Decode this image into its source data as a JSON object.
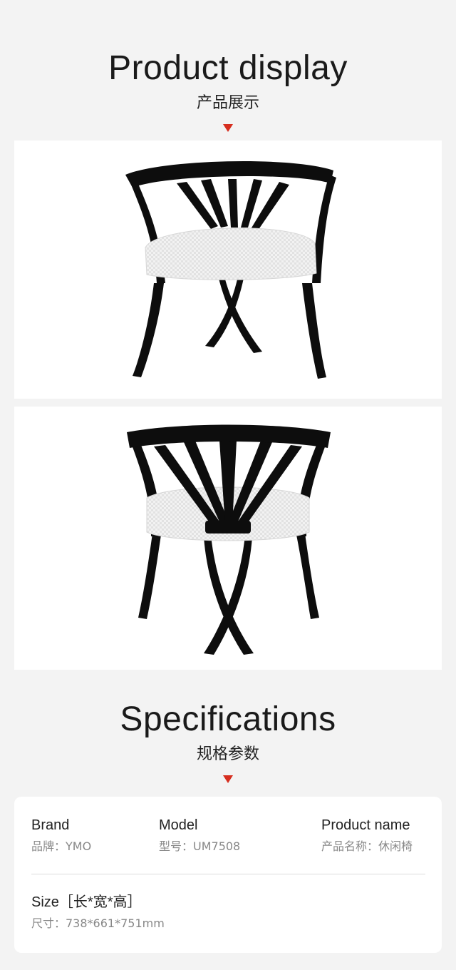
{
  "display": {
    "title_en": "Product display",
    "title_cn": "产品展示",
    "photos": [
      "chair-side-view",
      "chair-front-view"
    ]
  },
  "specs_section": {
    "title_en": "Specifications",
    "title_cn": "规格参数"
  },
  "specs": {
    "brand": {
      "label": "Brand",
      "value": "品牌：YMO"
    },
    "model": {
      "label": "Model",
      "value": "型号：UM7508"
    },
    "product_name": {
      "label": "Product name",
      "value": "产品名称：休闲椅"
    },
    "size": {
      "label": "Size［长*宽*高］",
      "value": "尺寸：738*661*751mm"
    }
  },
  "colors": {
    "background": "#f3f3f3",
    "accent_arrow": "#d62e1f",
    "frame": "#0d0d0d",
    "cushion": "#eeeeee"
  }
}
